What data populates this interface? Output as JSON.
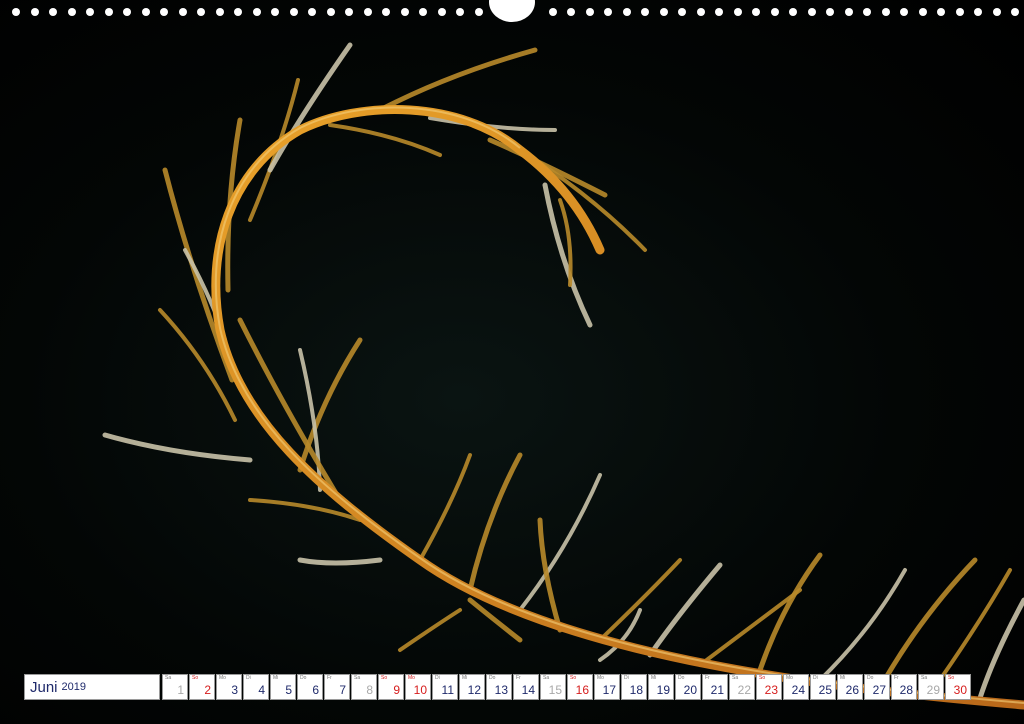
{
  "calendar": {
    "month": "Juni",
    "year": "2019",
    "days": [
      {
        "dow": "Sa",
        "num": "1",
        "type": "sat"
      },
      {
        "dow": "So",
        "num": "2",
        "type": "sun"
      },
      {
        "dow": "Mo",
        "num": "3",
        "type": "weekday"
      },
      {
        "dow": "Di",
        "num": "4",
        "type": "weekday"
      },
      {
        "dow": "Mi",
        "num": "5",
        "type": "weekday"
      },
      {
        "dow": "Do",
        "num": "6",
        "type": "weekday"
      },
      {
        "dow": "Fr",
        "num": "7",
        "type": "weekday"
      },
      {
        "dow": "Sa",
        "num": "8",
        "type": "sat"
      },
      {
        "dow": "So",
        "num": "9",
        "type": "sun"
      },
      {
        "dow": "Mo",
        "num": "10",
        "type": "holiday"
      },
      {
        "dow": "Di",
        "num": "11",
        "type": "weekday"
      },
      {
        "dow": "Mi",
        "num": "12",
        "type": "weekday"
      },
      {
        "dow": "Do",
        "num": "13",
        "type": "weekday"
      },
      {
        "dow": "Fr",
        "num": "14",
        "type": "weekday"
      },
      {
        "dow": "Sa",
        "num": "15",
        "type": "sat"
      },
      {
        "dow": "So",
        "num": "16",
        "type": "sun"
      },
      {
        "dow": "Mo",
        "num": "17",
        "type": "weekday"
      },
      {
        "dow": "Di",
        "num": "18",
        "type": "weekday"
      },
      {
        "dow": "Mi",
        "num": "19",
        "type": "weekday"
      },
      {
        "dow": "Do",
        "num": "20",
        "type": "weekday"
      },
      {
        "dow": "Fr",
        "num": "21",
        "type": "weekday"
      },
      {
        "dow": "Sa",
        "num": "22",
        "type": "sat"
      },
      {
        "dow": "So",
        "num": "23",
        "type": "sun"
      },
      {
        "dow": "Mo",
        "num": "24",
        "type": "weekday"
      },
      {
        "dow": "Di",
        "num": "25",
        "type": "weekday"
      },
      {
        "dow": "Mi",
        "num": "26",
        "type": "weekday"
      },
      {
        "dow": "Do",
        "num": "27",
        "type": "weekday"
      },
      {
        "dow": "Fr",
        "num": "28",
        "type": "weekday"
      },
      {
        "dow": "Sa",
        "num": "29",
        "type": "sat"
      },
      {
        "dow": "So",
        "num": "30",
        "type": "sun"
      }
    ]
  },
  "photo": {
    "subject": "feather-star-arm",
    "colors": {
      "background": "#000000",
      "stem": "#d98a1c",
      "pinnule_light": "#c9c2a8",
      "pinnule_gold": "#b8892a"
    }
  }
}
